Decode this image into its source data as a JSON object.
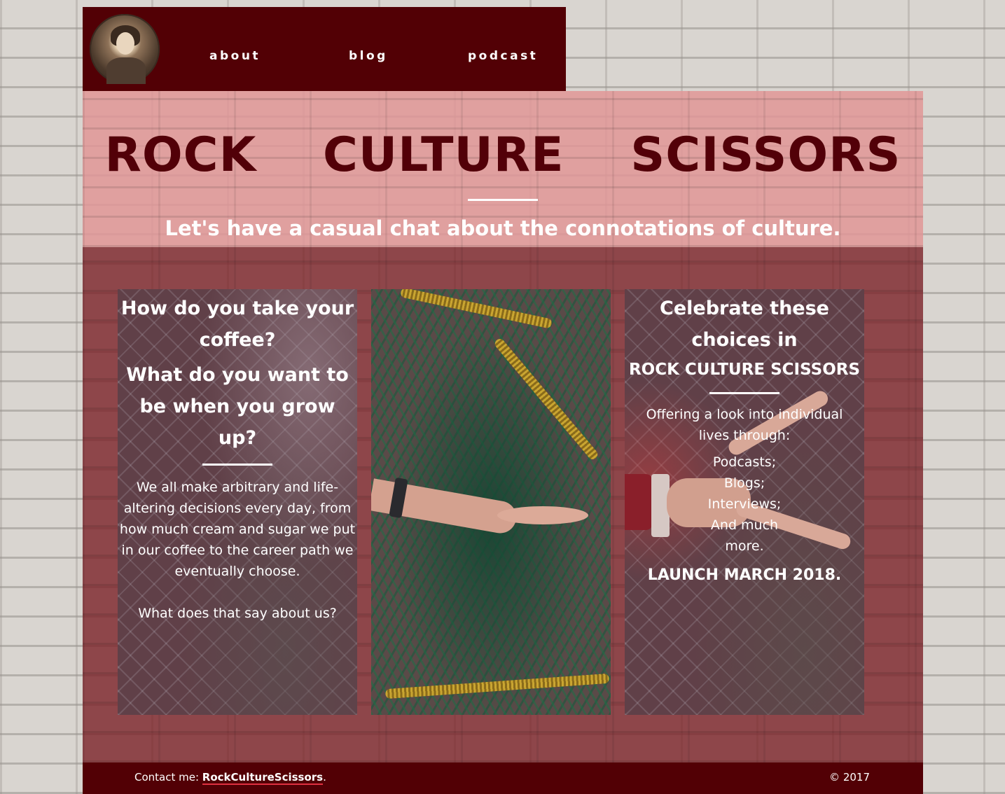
{
  "nav": {
    "links": [
      "about",
      "blog",
      "podcast"
    ]
  },
  "hero": {
    "title": "ROCK CULTURE SCISSORS",
    "tagline": "Let's have a casual chat about the connotations of culture."
  },
  "cards": {
    "left": {
      "heading1": "How do you take your coffee?",
      "heading2": "What do you want to be when you grow up?",
      "paragraph": "We all make arbitrary and life-altering decisions every day, from how much cream and sugar we put in our coffee to the career path we eventually choose.",
      "question": "What does that say about us?"
    },
    "right": {
      "heading": "Celebrate these choices in",
      "subheading": "ROCK CULTURE SCISSORS",
      "intro": "Offering a look into individual lives through:",
      "items": [
        "Podcasts;",
        "Blogs;",
        "Interviews;",
        "And much more."
      ],
      "launch": "LAUNCH MARCH 2018."
    }
  },
  "footer": {
    "contact_prefix": "Contact me: ",
    "contact_link": "RockCultureScissors",
    "contact_suffix": ".",
    "copyright": "© 2017"
  },
  "colors": {
    "nav_bg": "#520005",
    "hero_bg": "#e19696",
    "main_bg": "#781e24",
    "title": "#520008",
    "link_underline": "#e03040"
  },
  "icons": {
    "avatar": "vintage-portrait-avatar"
  }
}
